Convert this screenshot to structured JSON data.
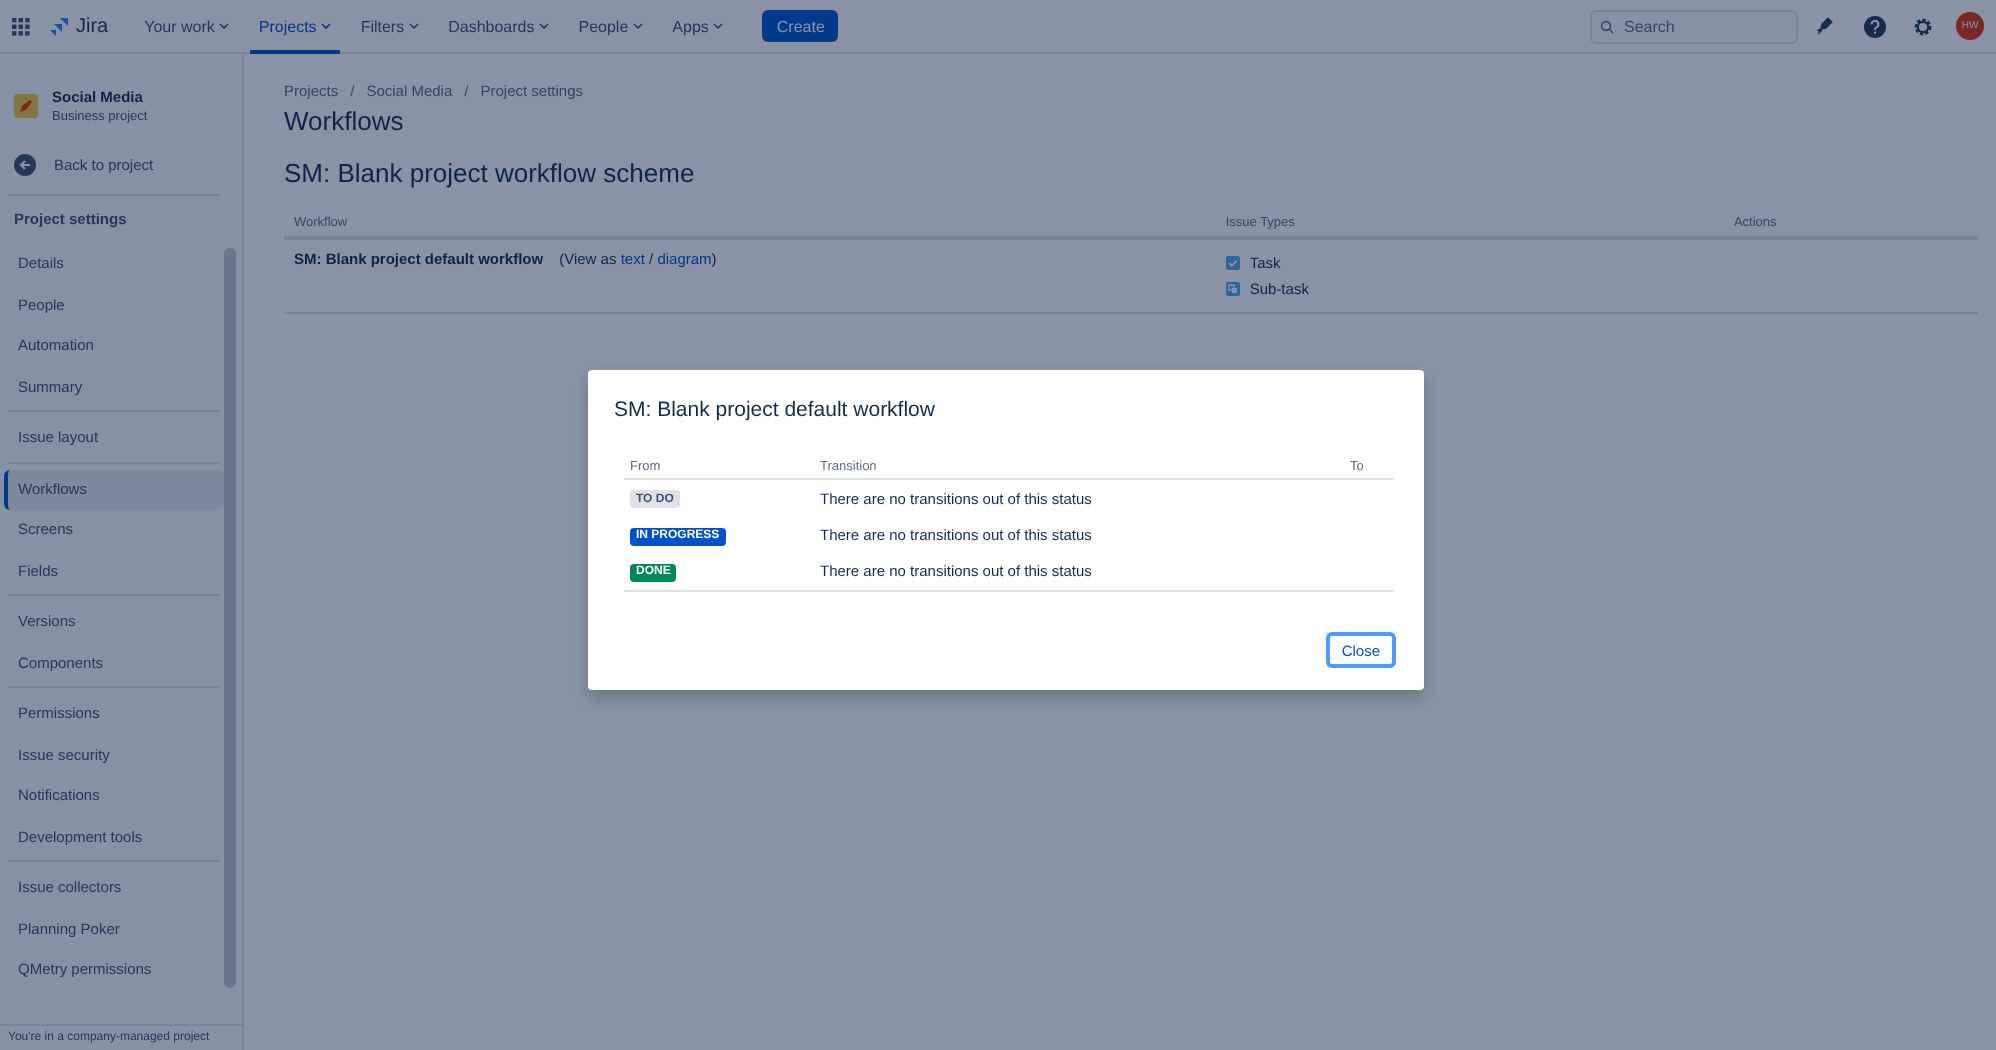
{
  "nav": {
    "logo": "Jira",
    "items": [
      {
        "label": "Your work",
        "selected": false
      },
      {
        "label": "Projects",
        "selected": true
      },
      {
        "label": "Filters",
        "selected": false
      },
      {
        "label": "Dashboards",
        "selected": false
      },
      {
        "label": "People",
        "selected": false
      },
      {
        "label": "Apps",
        "selected": false
      }
    ],
    "create": "Create",
    "search": {
      "placeholder": "Search"
    },
    "avatar": "HW"
  },
  "sidebar": {
    "project": {
      "name": "Social Media",
      "type": "Business project"
    },
    "back": "Back to project",
    "heading": "Project settings",
    "groups": [
      [
        {
          "label": "Details",
          "selected": false
        },
        {
          "label": "People",
          "selected": false
        },
        {
          "label": "Automation",
          "selected": false
        },
        {
          "label": "Summary",
          "selected": false
        }
      ],
      [
        {
          "label": "Issue layout",
          "selected": false
        }
      ],
      [
        {
          "label": "Workflows",
          "selected": true
        },
        {
          "label": "Screens",
          "selected": false
        },
        {
          "label": "Fields",
          "selected": false
        }
      ],
      [
        {
          "label": "Versions",
          "selected": false
        },
        {
          "label": "Components",
          "selected": false
        }
      ],
      [
        {
          "label": "Permissions",
          "selected": false
        },
        {
          "label": "Issue security",
          "selected": false
        },
        {
          "label": "Notifications",
          "selected": false
        },
        {
          "label": "Development tools",
          "selected": false
        }
      ],
      [
        {
          "label": "Issue collectors",
          "selected": false
        },
        {
          "label": "Planning Poker",
          "selected": false
        },
        {
          "label": "QMetry permissions",
          "selected": false
        }
      ]
    ],
    "footer": "You're in a company-managed project"
  },
  "breadcrumbs": [
    "Projects",
    "Social Media",
    "Project settings"
  ],
  "breadcrumb_separator": "/",
  "title": "Workflows",
  "scheme": "SM: Blank project workflow scheme",
  "table": {
    "columns": [
      "Workflow",
      "Issue Types",
      "Actions"
    ],
    "rows": [
      {
        "workflow": "SM: Blank project default workflow",
        "view_prefix": "(View as",
        "view_links": [
          "text",
          "diagram"
        ],
        "view_separator": "/",
        "view_suffix": ")",
        "issue_types": [
          {
            "kind": "task",
            "label": "Task"
          },
          {
            "kind": "subtask",
            "label": "Sub-task"
          }
        ]
      }
    ]
  },
  "dialog": {
    "title": "SM: Blank project default workflow",
    "columns": [
      "From",
      "Transition",
      "To"
    ],
    "rows": [
      {
        "status": "TO DO",
        "kind": "default",
        "transition": "There are no transitions out of this status"
      },
      {
        "status": "IN PROGRESS",
        "kind": "inprogress",
        "transition": "There are no transitions out of this status"
      },
      {
        "status": "DONE",
        "kind": "success",
        "transition": "There are no transitions out of this status"
      }
    ],
    "close": "Close"
  }
}
